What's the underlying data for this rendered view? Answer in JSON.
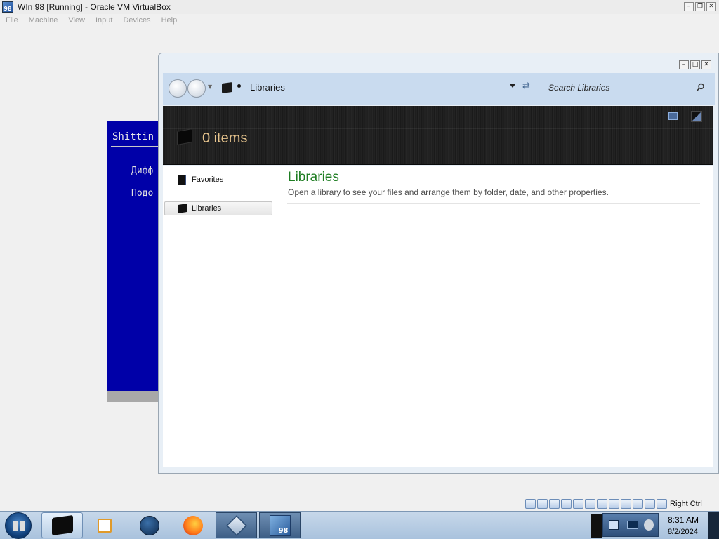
{
  "host": {
    "title": "WIn 98 [Running] - Oracle VM VirtualBox",
    "menu": [
      "File",
      "Machine",
      "View",
      "Input",
      "Devices",
      "Help"
    ],
    "win_ctrls": {
      "minimize": "–",
      "restore": "❐",
      "close": "✕"
    },
    "status_right_label": "Right Ctrl"
  },
  "guest_dialog": {
    "title_fragment": "Shittin",
    "options": [
      "Дифф",
      "Подо"
    ],
    "background_color": "#0000a8"
  },
  "explorer": {
    "win_ctrls": {
      "minimize": "–",
      "maximize": "□",
      "close": "✕"
    },
    "breadcrumb": "Libraries",
    "search_placeholder": "Search Libraries",
    "header": {
      "item_count": "0 items"
    },
    "nav": {
      "favorites": "Favorites",
      "libraries": "Libraries"
    },
    "main": {
      "title": "Libraries",
      "description": "Open a library to see your files and arrange them by folder, date, and other properties."
    },
    "colors": {
      "title_green": "#1e7d22",
      "count_gold": "#e8c58e"
    }
  },
  "taskbar": {
    "badge_98": "98",
    "clock": {
      "time": "8:31 AM",
      "date": "8/2/2024"
    },
    "pinned_icons": [
      "explorer-icon",
      "media-player-icon",
      "globe-icon",
      "firefox-icon",
      "virtualbox-icon",
      "win98-vm-icon"
    ]
  },
  "status_icons": [
    "hard-disk-icon",
    "optical-drive-icon",
    "floppy-icon",
    "network-icon",
    "usb-icon",
    "shared-folders-icon",
    "display-icon",
    "recording-icon",
    "cpu-icon",
    "mouse-integration-icon",
    "keyboard-icon",
    "host-key-icon"
  ]
}
